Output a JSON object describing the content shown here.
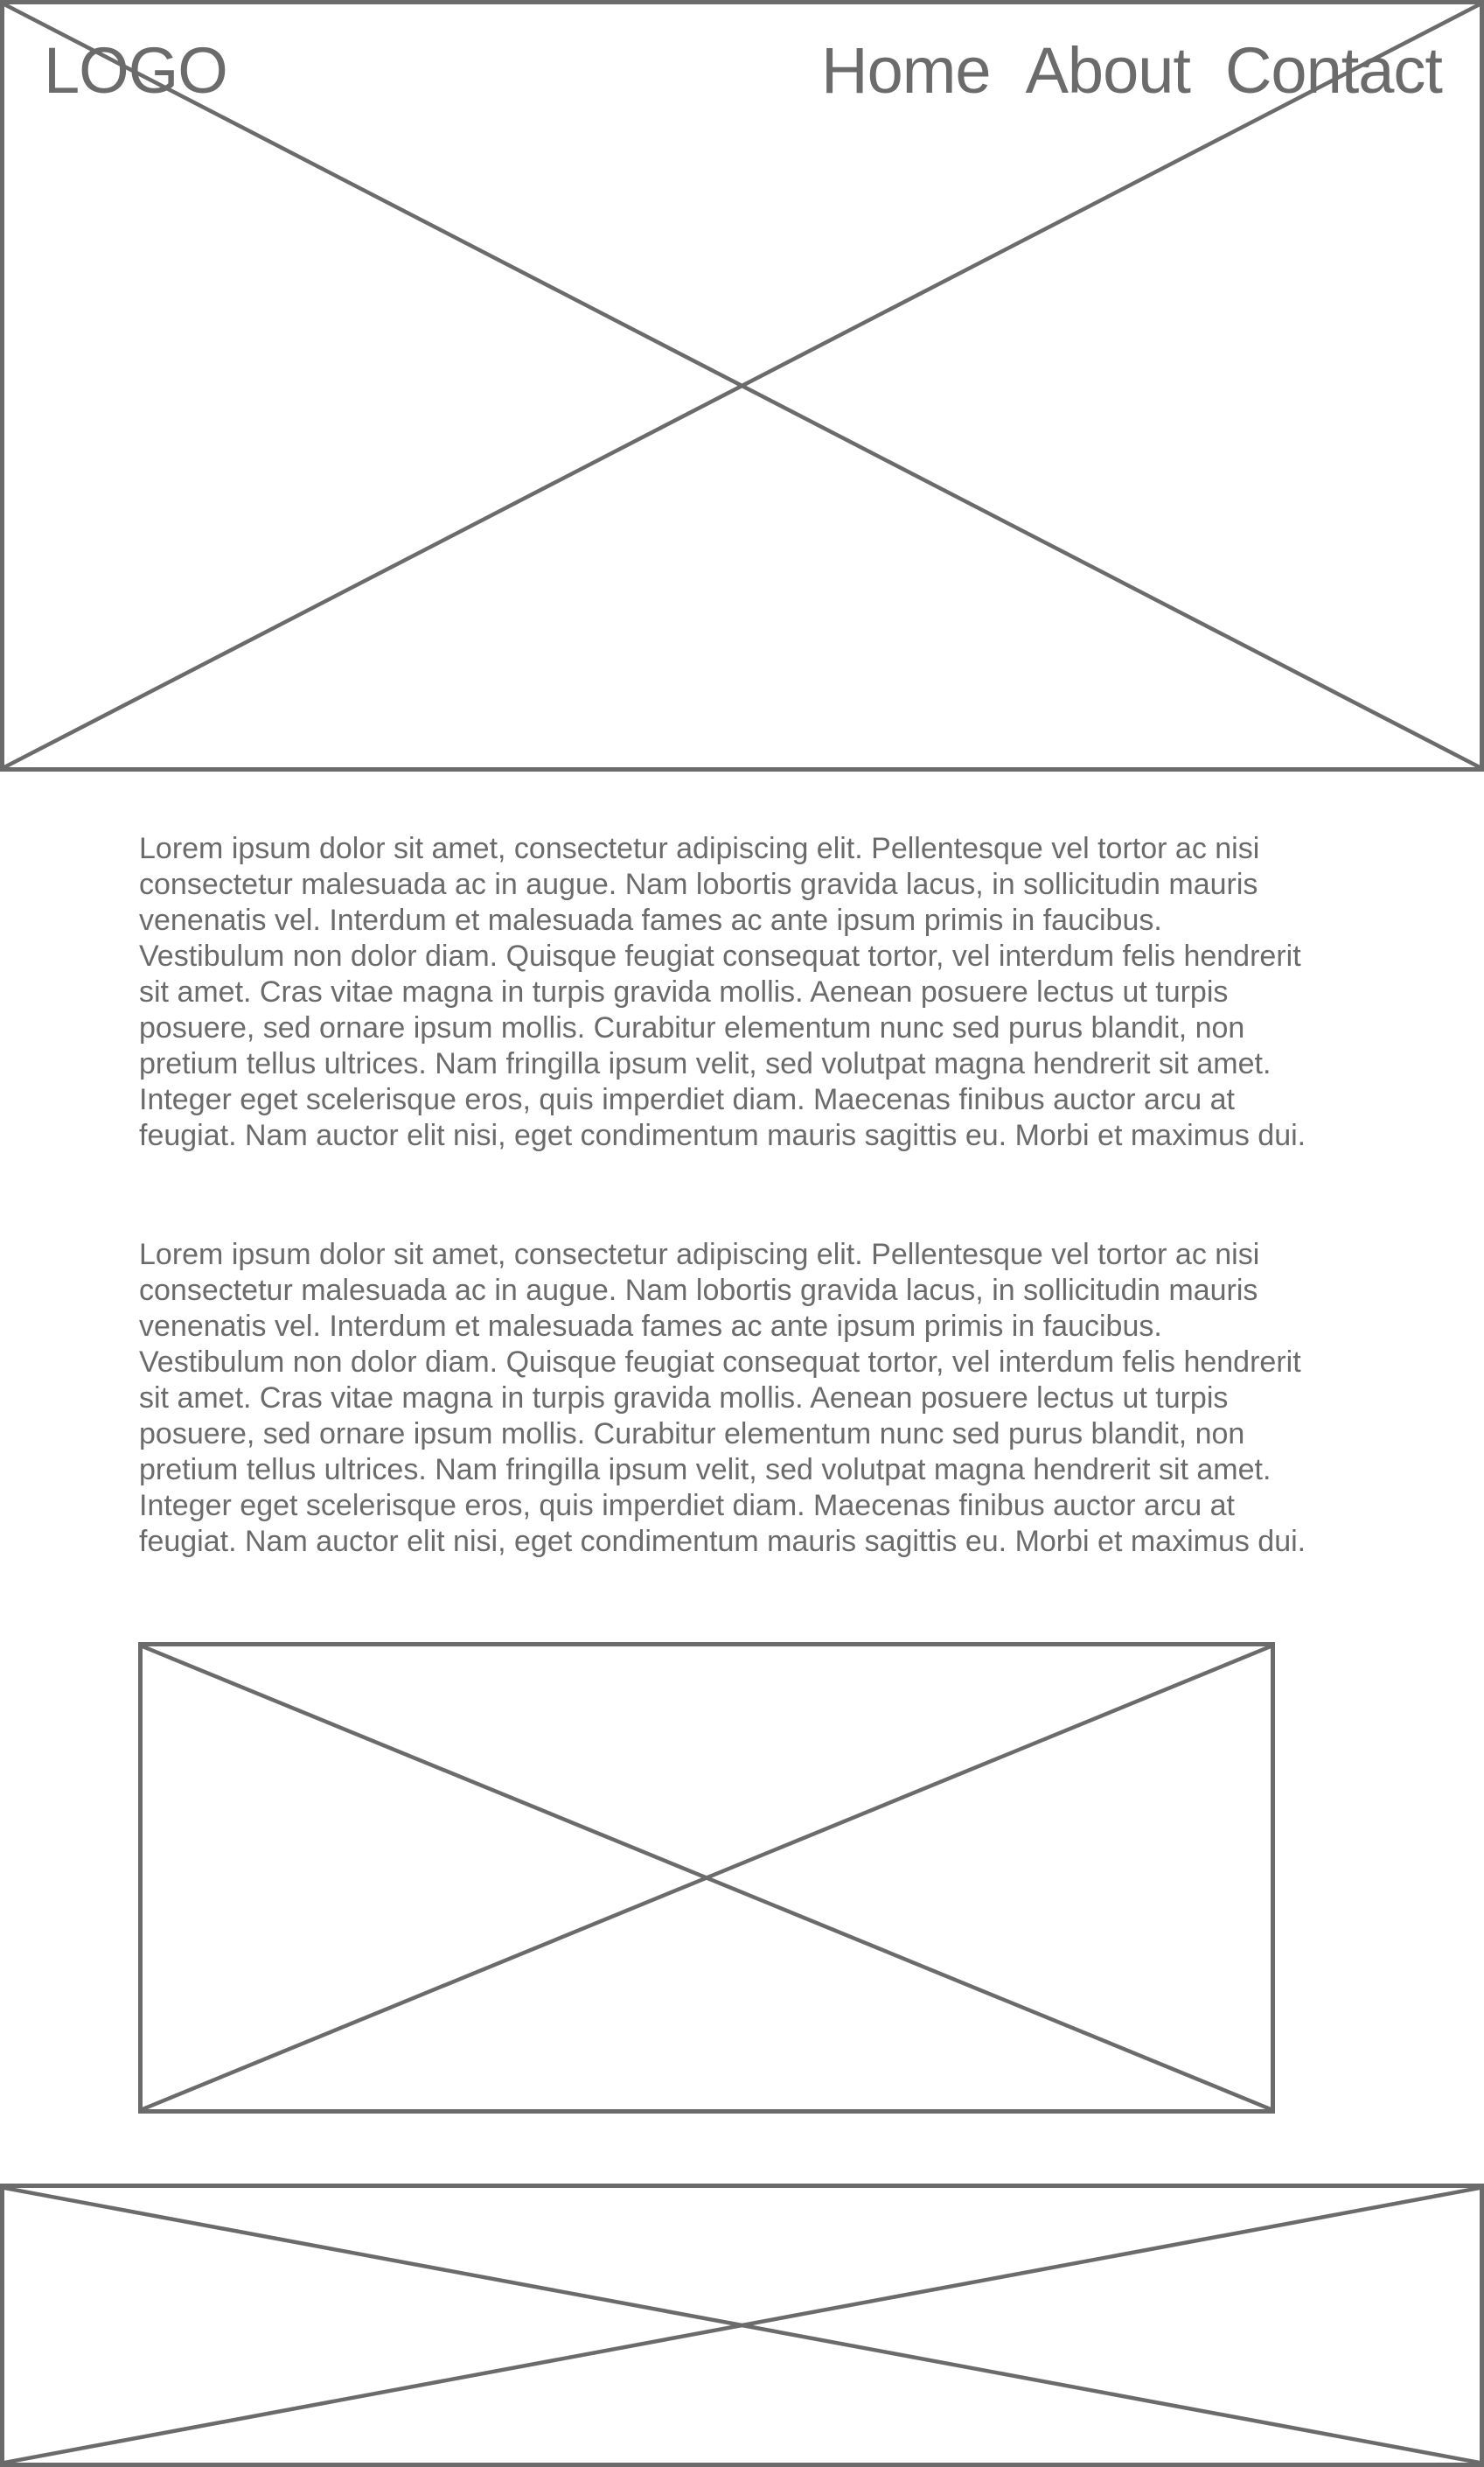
{
  "header": {
    "logo": "LOGO",
    "nav": [
      {
        "label": "Home"
      },
      {
        "label": "About"
      },
      {
        "label": "Contact"
      }
    ]
  },
  "content": {
    "paragraphs": [
      "Lorem ipsum dolor sit amet, consectetur adipiscing elit. Pellentesque vel tortor ac nisi consectetur malesuada ac in augue. Nam lobortis gravida lacus, in sollicitudin mauris venenatis vel. Interdum et malesuada fames ac ante ipsum primis in faucibus. Vestibulum non dolor diam. Quisque feugiat consequat tortor, vel interdum felis hendrerit sit amet. Cras vitae magna in turpis gravida mollis. Aenean posuere lectus ut turpis posuere, sed ornare ipsum mollis. Curabitur elementum nunc sed purus blandit, non pretium tellus ultrices. Nam fringilla ipsum velit, sed volutpat magna hendrerit sit amet. Integer eget scelerisque eros, quis imperdiet diam. Maecenas finibus auctor arcu at feugiat. Nam auctor elit nisi, eget condimentum mauris sagittis eu. Morbi et maximus dui.",
      "Lorem ipsum dolor sit amet, consectetur adipiscing elit. Pellentesque vel tortor ac nisi consectetur malesuada ac in augue. Nam lobortis gravida lacus, in sollicitudin mauris venenatis vel. Interdum et malesuada fames ac ante ipsum primis in faucibus. Vestibulum non dolor diam. Quisque feugiat consequat tortor, vel interdum felis hendrerit sit amet. Cras vitae magna in turpis gravida mollis. Aenean posuere lectus ut turpis posuere, sed ornare ipsum mollis. Curabitur elementum nunc sed purus blandit, non pretium tellus ultrices. Nam fringilla ipsum velit, sed volutpat magna hendrerit sit amet. Integer eget scelerisque eros, quis imperdiet diam. Maecenas finibus auctor arcu at feugiat. Nam auctor elit nisi, eget condimentum mauris sagittis eu. Morbi et maximus dui."
    ]
  },
  "theme": {
    "line_color": "#6b6b6b",
    "background": "#ffffff"
  },
  "icons": {
    "image_placeholder": "image-placeholder-icon"
  }
}
